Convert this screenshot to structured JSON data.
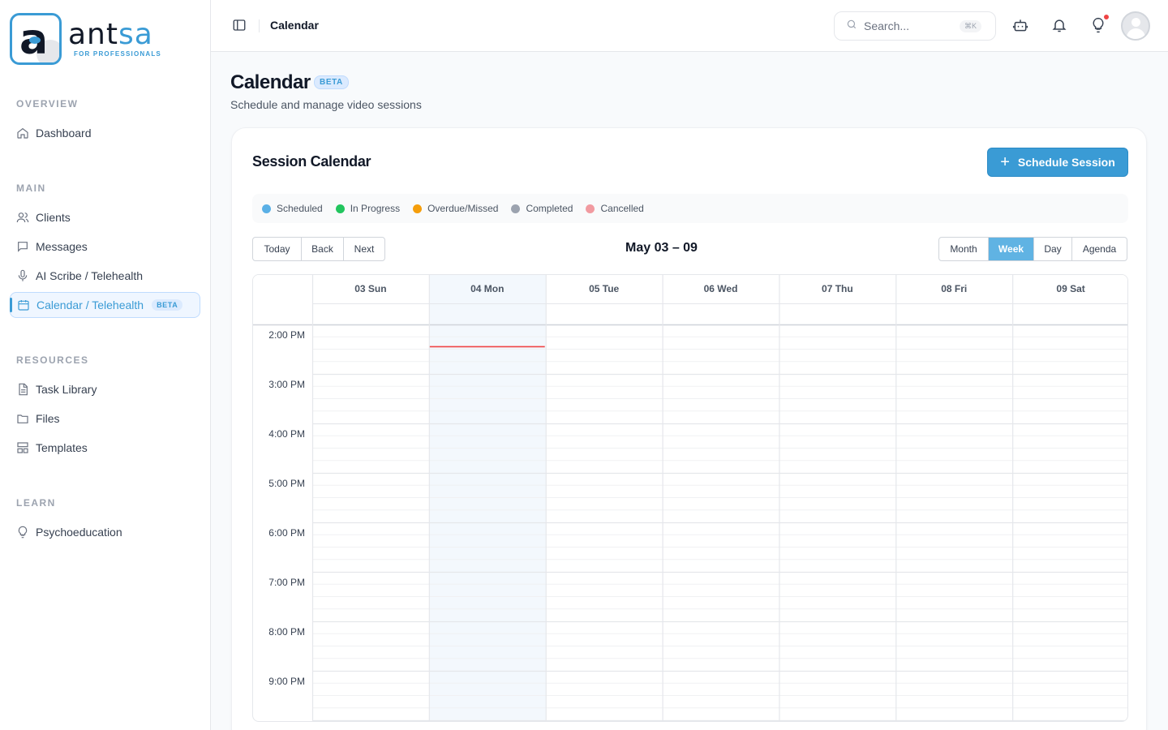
{
  "brand": {
    "word_a": "ant",
    "word_b": "sa",
    "subtitle": "FOR PROFESSIONALS"
  },
  "sidebar": {
    "sections": [
      {
        "label": "OVERVIEW"
      },
      {
        "label": "MAIN"
      },
      {
        "label": "RESOURCES"
      },
      {
        "label": "LEARN"
      }
    ],
    "items": [
      {
        "label": "Dashboard",
        "icon": "home-icon"
      },
      {
        "label": "Clients",
        "icon": "users-icon"
      },
      {
        "label": "Messages",
        "icon": "message-icon"
      },
      {
        "label": "AI Scribe / Telehealth",
        "icon": "microphone-icon"
      },
      {
        "label": "Calendar / Telehealth",
        "icon": "calendar-icon",
        "badge": "BETA",
        "active": true
      },
      {
        "label": "Task Library",
        "icon": "document-icon"
      },
      {
        "label": "Files",
        "icon": "folder-icon"
      },
      {
        "label": "Templates",
        "icon": "templates-icon"
      },
      {
        "label": "Psychoeducation",
        "icon": "lightbulb-icon"
      }
    ]
  },
  "topbar": {
    "title": "Calendar",
    "search_placeholder": "Search...",
    "search_shortcut": "⌘K"
  },
  "page": {
    "title": "Calendar",
    "badge": "BETA",
    "subtitle": "Schedule and manage video sessions"
  },
  "card": {
    "title": "Session Calendar",
    "schedule_button": "Schedule Session"
  },
  "legend": [
    {
      "label": "Scheduled",
      "color": "#5ab0e6"
    },
    {
      "label": "In Progress",
      "color": "#22c55e"
    },
    {
      "label": "Overdue/Missed",
      "color": "#f59e0b"
    },
    {
      "label": "Completed",
      "color": "#9ca3af"
    },
    {
      "label": "Cancelled",
      "color": "#f19aa0"
    }
  ],
  "navigation": {
    "today": "Today",
    "back": "Back",
    "next": "Next"
  },
  "range_label": "May 03 – 09",
  "views": {
    "month": "Month",
    "week": "Week",
    "day": "Day",
    "agenda": "Agenda",
    "selected": "Week"
  },
  "calendar": {
    "days": [
      "03 Sun",
      "04 Mon",
      "05 Tue",
      "06 Wed",
      "07 Thu",
      "08 Fri",
      "09 Sat"
    ],
    "today_index": 1,
    "times": [
      "2:00 PM",
      "3:00 PM",
      "4:00 PM",
      "5:00 PM",
      "6:00 PM",
      "7:00 PM",
      "8:00 PM",
      "9:00 PM"
    ],
    "now_time_hours_after_first": 0.45,
    "slots_per_hour": 4,
    "colors": {
      "today_bg": "#f3f8fd",
      "now_line": "#ef4444",
      "grid_line": "#e5e7eb",
      "minor_line": "#f0f1f3"
    }
  }
}
